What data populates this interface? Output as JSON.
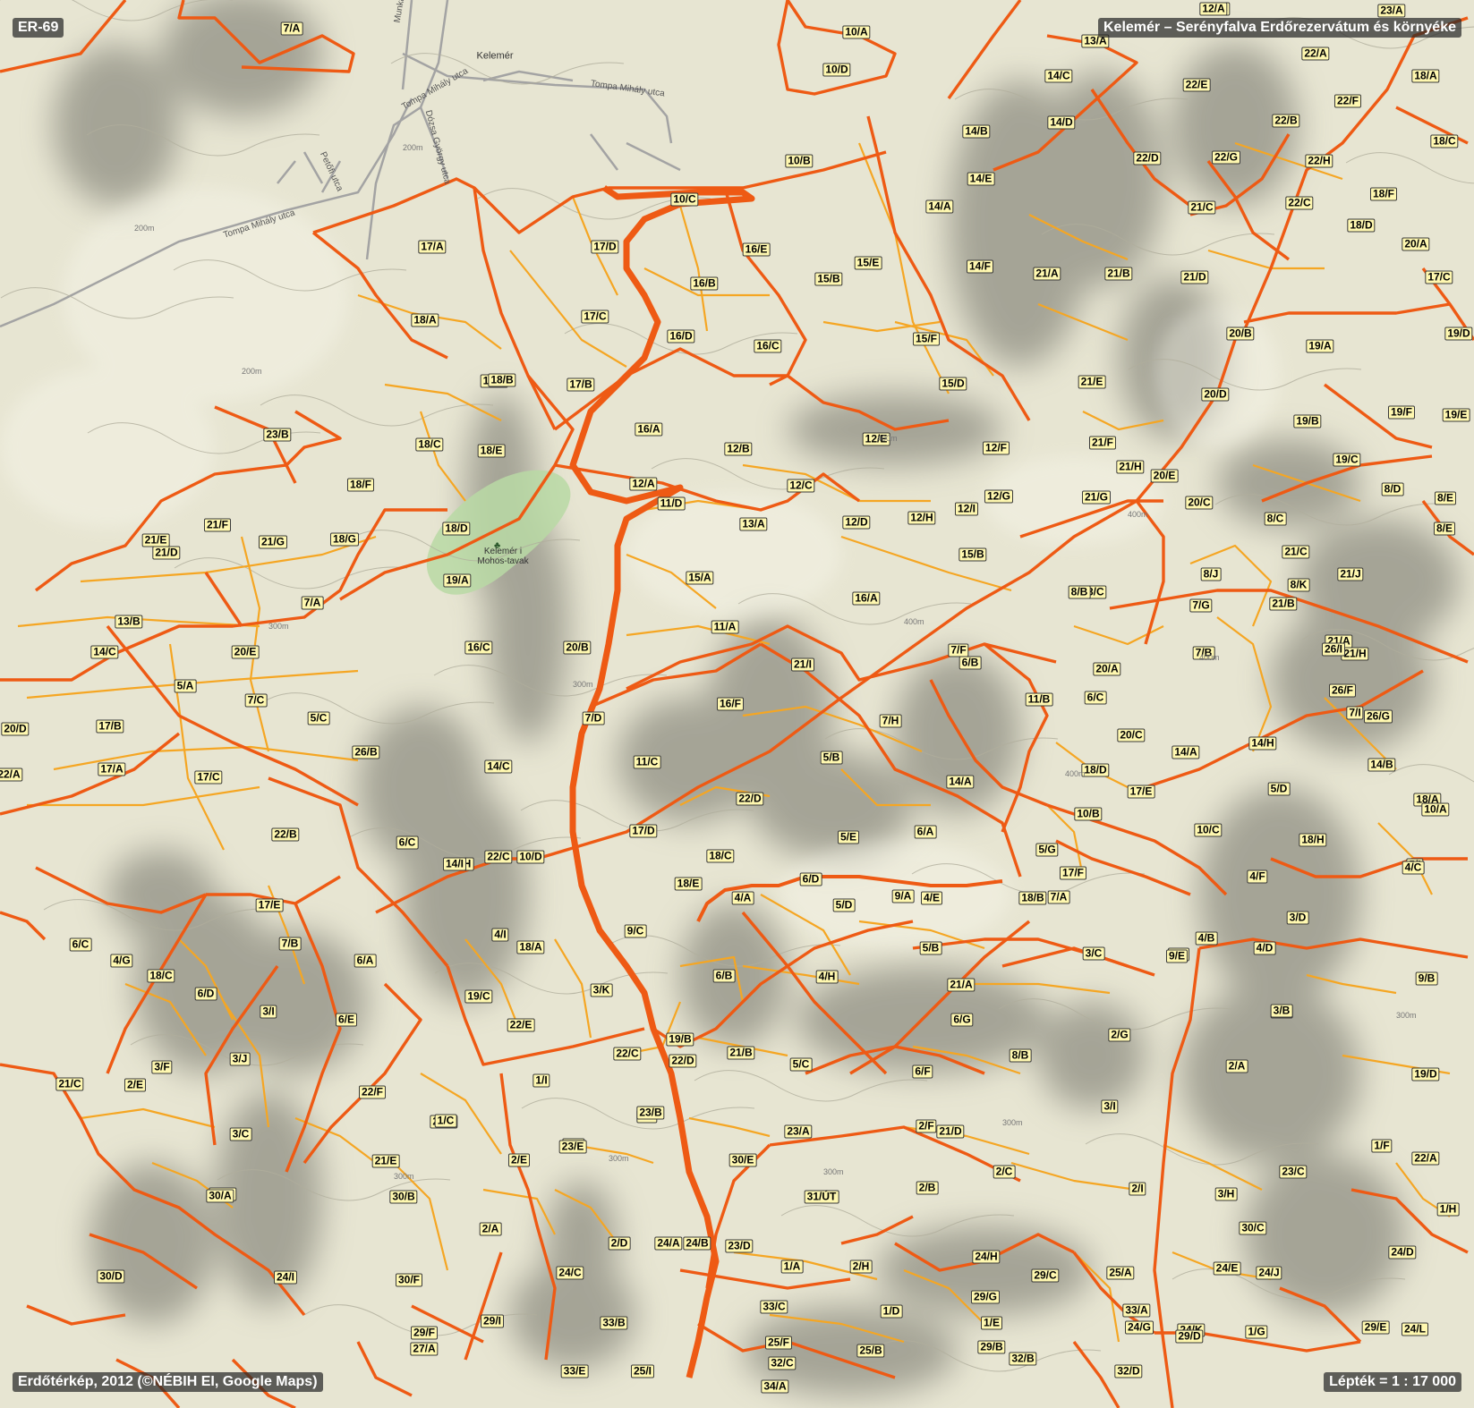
{
  "map": {
    "code": "ER-69",
    "title": "Kelemér – Serényfalva Erdőrezervátum és környéke",
    "credit": "Erdőtérkép, 2012 (©NÉBIH EI, Google Maps)",
    "scale": "Lépték = 1 : 17 000",
    "colors": {
      "background": "#e7e5d2",
      "hill_shade": "#7d7d74",
      "boundary_main": "#ee5a14",
      "boundary_sub": "#f5a623",
      "road": "#9a9a9a",
      "park": "#b9d9a4"
    },
    "village": "Kelemér",
    "park_label": "Kelemér i Mohos-tavak",
    "streets": [
      "Tompa Mihály utca",
      "Tompa Mihály utca",
      "Tompa Mihály utca",
      "Munkástelep utca",
      "Dózsa György utca",
      "Petőfi utca"
    ],
    "contour_labels": [
      "200m",
      "200m",
      "200m",
      "300m",
      "300m",
      "300m",
      "300m",
      "300m",
      "300m",
      "300m",
      "400m",
      "400m",
      "400m",
      "400m",
      "400m"
    ],
    "subcompartments": [
      "7/A",
      "10/A",
      "10/D",
      "13/C",
      "12/A",
      "23/A",
      "13/A",
      "14/C",
      "22/A",
      "18/A",
      "22/E",
      "22/F",
      "14/D",
      "22/B",
      "14/B",
      "18/C",
      "22/G",
      "22/D",
      "22/H",
      "10/B",
      "14/E",
      "18/F",
      "10/C",
      "21/C",
      "22/C",
      "18/D",
      "14/A",
      "17/A",
      "17/D",
      "16/E",
      "20/A",
      "16/B",
      "15/E",
      "21/A",
      "21/B",
      "21/D",
      "17/C",
      "15/B",
      "14/F",
      "18/A",
      "17/C",
      "18/E",
      "16/D",
      "16/C",
      "15/F",
      "20/B",
      "19/A",
      "19/D",
      "18/B",
      "17/B",
      "21/E",
      "15/D",
      "20/D",
      "19/F",
      "19/E",
      "23/B",
      "16/A",
      "12/E",
      "12/F",
      "21/F",
      "18/C",
      "18/E",
      "12/B",
      "21/H",
      "20/E",
      "19/C",
      "18/F",
      "19/B",
      "12/A",
      "12/C",
      "12/G",
      "21/G",
      "8/D",
      "8/E",
      "11/D",
      "13/A",
      "12/D",
      "12/H",
      "12/I",
      "20/C",
      "8/C",
      "21/F",
      "21/E",
      "21/G",
      "18/G",
      "18/D",
      "21/D",
      "8/E",
      "15/B",
      "21/C",
      "19/A",
      "13/C",
      "15/A",
      "16/A",
      "8/B",
      "8/J",
      "8/K",
      "21/J",
      "7/A",
      "7/G",
      "21/B",
      "13/B",
      "11/A",
      "20/B",
      "16/C",
      "7/F",
      "7/B",
      "21/A",
      "21/H",
      "14/C",
      "20/E",
      "26/I",
      "21/I",
      "20/A",
      "14/B",
      "5/A",
      "7/C",
      "16/F",
      "6/C",
      "26/F",
      "11/B",
      "20/D",
      "17/B",
      "7/D",
      "5/C",
      "7/H",
      "7/I",
      "20/C",
      "14/A",
      "14/H",
      "26/B",
      "26/G",
      "11/C",
      "22/A",
      "17/A",
      "14/C",
      "17/C",
      "5/B",
      "6/B",
      "14/A",
      "18/D",
      "5/D",
      "14/B",
      "22/D",
      "18/A",
      "17/E",
      "17/D",
      "22/B",
      "5/E",
      "6/A",
      "10/A",
      "10/B",
      "10/C",
      "6/C",
      "5/H",
      "22/C",
      "10/D",
      "18/H",
      "5/G",
      "5/I",
      "14/I",
      "18/C",
      "17/F",
      "4/C",
      "18/E",
      "6/D",
      "7/A",
      "3/D",
      "4/A",
      "4/F",
      "9/A",
      "4/E",
      "17/E",
      "18/B",
      "4/I",
      "5/D",
      "9/C",
      "4/B",
      "6/C",
      "18/A",
      "5/B",
      "7/B",
      "4/D",
      "4/G",
      "6/A",
      "3/C",
      "3/E",
      "18/C",
      "6/B",
      "9/B",
      "9/E",
      "4/H",
      "21/A",
      "6/D",
      "19/C",
      "9/D",
      "3/K",
      "3/I",
      "22/E",
      "6/E",
      "6/G",
      "19/B",
      "2/G",
      "3/B",
      "3/F",
      "3/J",
      "22/C",
      "22/D",
      "21/B",
      "5/C",
      "6/F",
      "8/B",
      "2/A",
      "21/C",
      "2/E",
      "22/F",
      "1/I",
      "19/D",
      "2/F",
      "3/I",
      "22/B",
      "3/C",
      "1/C",
      "3/G",
      "23/A",
      "21/D",
      "21/E",
      "2/E",
      "30/E",
      "2/F",
      "1/F",
      "22/A",
      "23/B",
      "23/C",
      "23/E",
      "30/B",
      "19/A",
      "31/ÚT",
      "2/B",
      "2/C",
      "2/I",
      "3/H",
      "30/A",
      "1/H",
      "2/D",
      "24/A",
      "24/B",
      "23/D",
      "30/C",
      "2/A",
      "1/A",
      "2/H",
      "24/H",
      "24/D",
      "30/D",
      "30/F",
      "24/C",
      "29/C",
      "25/A",
      "24/E",
      "24/J",
      "24/I",
      "29/G",
      "33/A",
      "33/B",
      "33/C",
      "1/D",
      "1/E",
      "24/G",
      "24/K",
      "1/G",
      "24/L",
      "29/I",
      "29/F",
      "25/F",
      "25/B",
      "27/A",
      "29/B",
      "29/D",
      "29/E",
      "32/C",
      "32/B",
      "32/D",
      "33/E",
      "25/I",
      "34/A"
    ]
  }
}
